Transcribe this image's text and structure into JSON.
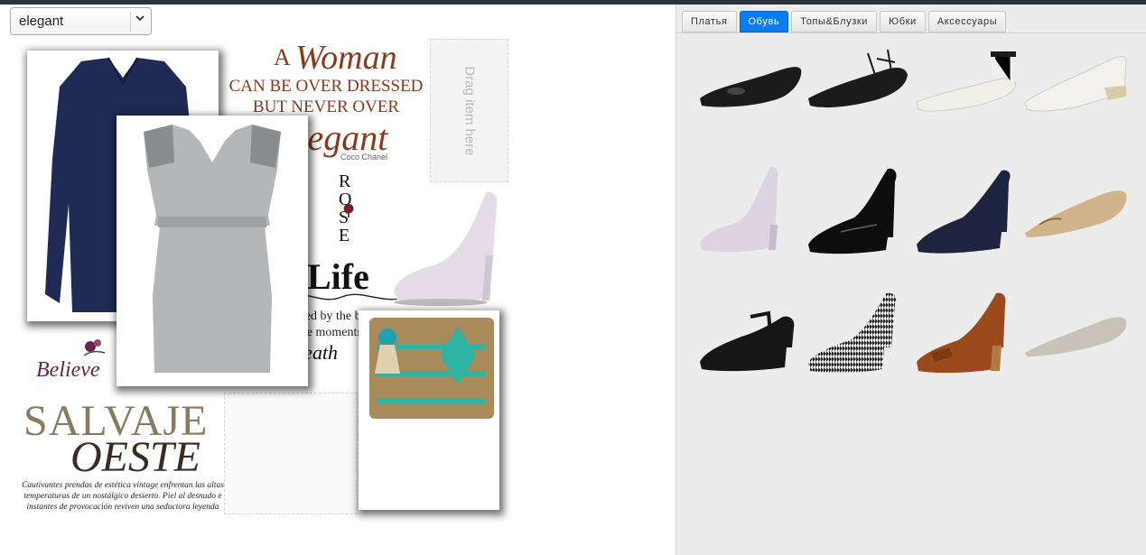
{
  "collage_select": {
    "value": "elegant"
  },
  "drop_slot": {
    "label": "Drag item here"
  },
  "quote": {
    "line1_a": "A",
    "line1_b": "Woman",
    "line2": "CAN BE OVER DRESSED",
    "line3": "BUT NEVER OVER",
    "line4": "Elegant",
    "author": "Coco Chanel"
  },
  "rose_text": {
    "letters": "R O S E"
  },
  "life_text": {
    "title": "Life",
    "line1": "t measured by the breaths w",
    "line2": "out by the moments tha",
    "line3": "Breath"
  },
  "believe_text": {
    "word": "Believe"
  },
  "salvaje": {
    "title1": "SALVAJE",
    "title2": "OESTE",
    "body": "Cautivantes prendas de estética vintage enfrentan las altas temperaturas de un nostálgico desierto. Piel al desnudo e instantes de provocación reviven una seductora leyenda"
  },
  "tabs": [
    {
      "label": "Платья",
      "active": false
    },
    {
      "label": "Обувь",
      "active": true
    },
    {
      "label": "Топы&Блузки",
      "active": false
    },
    {
      "label": "Юбки",
      "active": false
    },
    {
      "label": "Аксессуары",
      "active": false
    }
  ],
  "colors": {
    "accent": "#0a7cf2",
    "topbar": "#2b333b",
    "quote_brown": "#8a3a1c"
  },
  "shoes": [
    {
      "name": "black-loafer-icon",
      "color": "#1b1b1b"
    },
    {
      "name": "black-lace-up-flat-icon",
      "color": "#1b1b1b"
    },
    {
      "name": "white-ankle-strap-flat-icon",
      "color": "#f1efe6"
    },
    {
      "name": "white-wedge-icon",
      "color": "#f4f1ea"
    },
    {
      "name": "lilac-platform-pump-icon",
      "color": "#ddd4e2"
    },
    {
      "name": "black-patent-pump-icon",
      "color": "#0d0d0d"
    },
    {
      "name": "navy-suede-pump-icon",
      "color": "#1d2440"
    },
    {
      "name": "beige-ballerina-icon",
      "color": "#d2b48c"
    },
    {
      "name": "black-mary-jane-icon",
      "color": "#161616"
    },
    {
      "name": "houndstooth-pump-icon",
      "color": "#8b8b8b"
    },
    {
      "name": "brown-fringe-pump-icon",
      "color": "#9b4a1d"
    },
    {
      "name": "grey-ballerina-icon",
      "color": "#c9c2b8"
    }
  ]
}
